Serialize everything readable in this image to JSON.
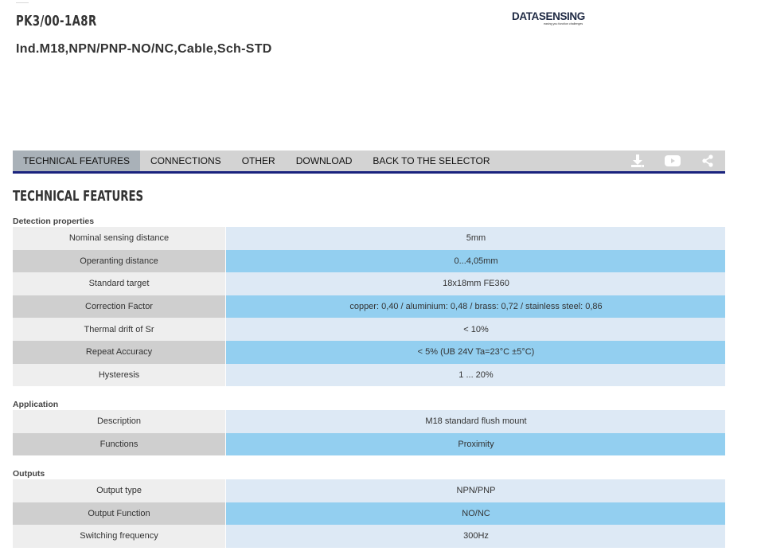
{
  "header": {
    "product_code": "PK3/00-1A8R",
    "product_description": "Ind.M18,NPN/PNP-NO/NC,Cable,Sch-STD",
    "logo_text": "DATASENSING",
    "logo_tagline": "easing you function challenges"
  },
  "tabs": [
    {
      "label": "TECHNICAL FEATURES",
      "active": true
    },
    {
      "label": "CONNECTIONS",
      "active": false
    },
    {
      "label": "OTHER",
      "active": false
    },
    {
      "label": "DOWNLOAD",
      "active": false
    },
    {
      "label": "BACK TO THE SELECTOR",
      "active": false
    }
  ],
  "toolbar_icons": [
    "download-icon",
    "youtube-icon",
    "share-icon"
  ],
  "section_title": "TECHNICAL FEATURES",
  "groups": [
    {
      "label": "Detection properties",
      "rows": [
        {
          "key": "Nominal sensing distance",
          "value": "5mm"
        },
        {
          "key": "Operanting distance",
          "value": "0...4,05mm"
        },
        {
          "key": "Standard target",
          "value": "18x18mm FE360"
        },
        {
          "key": "Correction Factor",
          "value": "copper: 0,40 / aluminium: 0,48 / brass: 0,72 / stainless steel: 0,86"
        },
        {
          "key": "Thermal drift of Sr",
          "value": "< 10%"
        },
        {
          "key": "Repeat Accuracy",
          "value": "< 5% (UB 24V Ta=23°C ±5°C)"
        },
        {
          "key": "Hysteresis",
          "value": "1 ... 20%"
        }
      ]
    },
    {
      "label": "Application",
      "rows": [
        {
          "key": "Description",
          "value": "M18 standard flush mount"
        },
        {
          "key": "Functions",
          "value": "Proximity"
        }
      ]
    },
    {
      "label": "Outputs",
      "rows": [
        {
          "key": "Output type",
          "value": "NPN/PNP"
        },
        {
          "key": "Output Function",
          "value": "NO/NC"
        },
        {
          "key": "Switching frequency",
          "value": "300Hz"
        }
      ]
    }
  ],
  "colors": {
    "tab_bar": "#d3d3d3",
    "tab_active": "#a9b1b8",
    "tab_underline": "#1a237e",
    "row_key_light": "#eeeeee",
    "row_key_dark": "#cfcfcf",
    "row_value_light": "#dde9f5",
    "row_value_dark": "#93cff0"
  }
}
